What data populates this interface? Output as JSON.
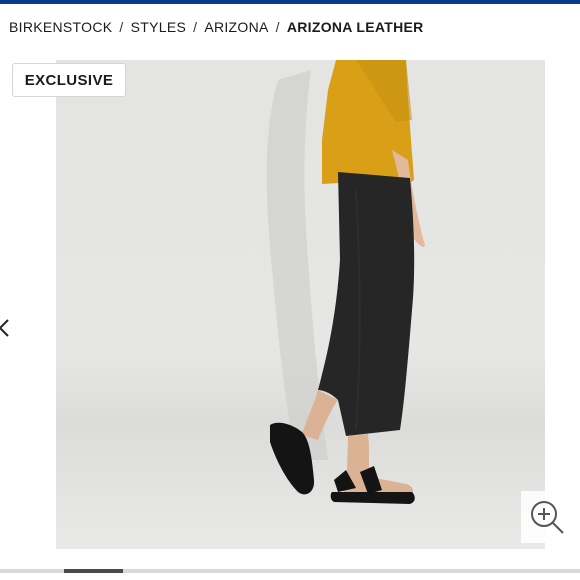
{
  "breadcrumb": {
    "items": [
      "BIRKENSTOCK",
      "STYLES",
      "ARIZONA"
    ],
    "current": "ARIZONA LEATHER",
    "separator": "/"
  },
  "gallery": {
    "badge": "EXCLUSIVE",
    "image_alt": "Model wearing black Arizona leather sandals",
    "active_slide_fraction": 0.16,
    "slider_position_fraction": 0.11
  },
  "colors": {
    "accent": "#0d3b8c",
    "shirt": "#d9a017",
    "pants": "#262626",
    "sandal": "#141414"
  },
  "icons": {
    "prev": "chevron-left-icon",
    "zoom": "zoom-in-icon"
  }
}
